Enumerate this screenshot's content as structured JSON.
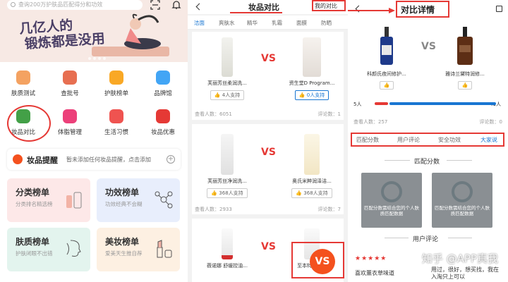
{
  "panel1": {
    "search_placeholder": "查询200万护肤品匹配得分和功效",
    "banner_line1": "几亿人的",
    "banner_line2": "锻炼都是没用",
    "grid": [
      {
        "label": "肤质测试",
        "icon": "face-test-icon",
        "color": "#f4a261"
      },
      {
        "label": "查批号",
        "icon": "batch-search-icon",
        "color": "#e76f51"
      },
      {
        "label": "护肤榜单",
        "icon": "ranking-icon",
        "color": "#f9a825"
      },
      {
        "label": "品牌馆",
        "icon": "brand-icon",
        "color": "#42a5f5"
      },
      {
        "label": "妆品对比",
        "icon": "compare-icon",
        "color": "#43a047"
      },
      {
        "label": "体脂管理",
        "icon": "body-fat-icon",
        "color": "#ec407a"
      },
      {
        "label": "生活习惯",
        "icon": "habit-icon",
        "color": "#ef5350"
      },
      {
        "label": "妆品优惠",
        "icon": "discount-icon",
        "color": "#e53935"
      }
    ],
    "reminder_title": "妆品提醒",
    "reminder_sub": "暂未添加任何妆品提醒，点击添加",
    "cards": [
      {
        "title": "分类榜单",
        "sub": "分类排名精选榜",
        "bg": "#fde8e8"
      },
      {
        "title": "功效榜单",
        "sub": "功效经典不会糊",
        "bg": "#e8eefc"
      },
      {
        "title": "肤质榜单",
        "sub": "护肤闭眼不出错",
        "bg": "#e3f4ee"
      },
      {
        "title": "美妆榜单",
        "sub": "爱美天生推自荐",
        "bg": "#fdf0e2"
      }
    ]
  },
  "panel2": {
    "title": "妆品对比",
    "my_compare": "我的对比",
    "tabs": [
      "洁面",
      "爽肤水",
      "精华",
      "乳霜",
      "面膜",
      "防晒"
    ],
    "vs": "VS",
    "rows": [
      {
        "left_name": "芙丽芳丝柔润洗...",
        "right_name": "资生堂D Program...",
        "left_support": "4人支持",
        "right_support": "0人支持",
        "views": "查看人数：6051",
        "comments": "评论数：1"
      },
      {
        "left_name": "芙丽芳丝净润洗...",
        "right_name": "奥氏米粹润泽洁...",
        "left_support": "368人支持",
        "right_support": "368人支持",
        "views": "查看人数：2933",
        "comments": "评论数：7"
      },
      {
        "left_name": "薇诺娜 舒缓控油...",
        "right_name": "至本特安修...",
        "left_support": "",
        "right_support": "",
        "views": "",
        "comments": ""
      }
    ],
    "vs_badge": "VS"
  },
  "panel3": {
    "title": "对比详情",
    "left_product": "科颜氏夜间修护...",
    "right_product": "雅诗兰黛特润修...",
    "vs": "VS",
    "left_votes": "5人",
    "right_votes": "41人",
    "left_fraction": 0.11,
    "views": "查看人数：257",
    "comments": "评论数：0",
    "tabs": [
      "匹配分数",
      "用户评论",
      "安全功效",
      "大家说"
    ],
    "section_match": "匹配分数",
    "lock_text": "匹配分数需结合您的个人肤质匹配数据",
    "section_comments": "用户评论",
    "comment_left": "喜欢薰衣草味道",
    "comment_right": "用过，很好，想买找，我在入淘只上可以",
    "watermark": "知乎 @APP真我"
  }
}
